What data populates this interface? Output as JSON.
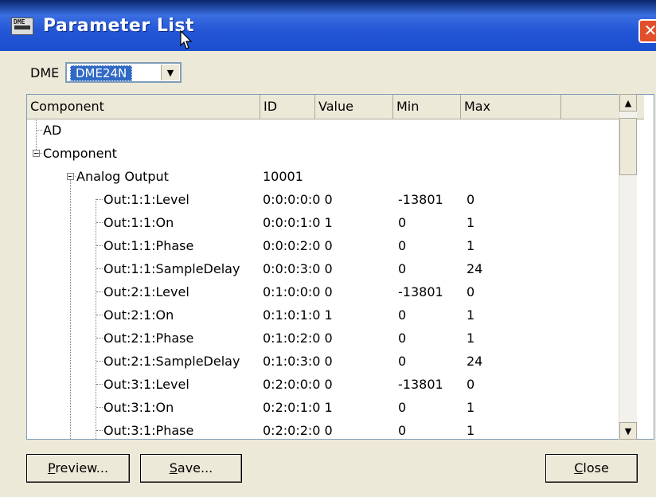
{
  "window": {
    "title": "Parameter List",
    "app_icon_text": "DME"
  },
  "dme": {
    "label": "DME",
    "selected": "DME24N"
  },
  "columns": [
    "Component",
    "ID",
    "Value",
    "Min",
    "Max"
  ],
  "rows": [
    {
      "name": "AD",
      "id": "",
      "min": "",
      "max": "",
      "level": 0
    },
    {
      "name": "Component",
      "id": "",
      "min": "",
      "max": "",
      "level": 0,
      "expanded": true
    },
    {
      "name": "Analog Output",
      "id": "10001",
      "min": "",
      "max": "",
      "level": 1,
      "expanded": true
    },
    {
      "name": "Out:1:1:Level",
      "id": "0:0:0:0:0 0",
      "min": "-13801",
      "max": "0",
      "level": 2
    },
    {
      "name": "Out:1:1:On",
      "id": "0:0:0:1:0 1",
      "min": "0",
      "max": "1",
      "level": 2
    },
    {
      "name": "Out:1:1:Phase",
      "id": "0:0:0:2:0 0",
      "min": "0",
      "max": "1",
      "level": 2
    },
    {
      "name": "Out:1:1:SampleDelay",
      "id": "0:0:0:3:0 0",
      "min": "0",
      "max": "24",
      "level": 2
    },
    {
      "name": "Out:2:1:Level",
      "id": "0:1:0:0:0 0",
      "min": "-13801",
      "max": "0",
      "level": 2
    },
    {
      "name": "Out:2:1:On",
      "id": "0:1:0:1:0 1",
      "min": "0",
      "max": "1",
      "level": 2
    },
    {
      "name": "Out:2:1:Phase",
      "id": "0:1:0:2:0 0",
      "min": "0",
      "max": "1",
      "level": 2
    },
    {
      "name": "Out:2:1:SampleDelay",
      "id": "0:1:0:3:0 0",
      "min": "0",
      "max": "24",
      "level": 2
    },
    {
      "name": "Out:3:1:Level",
      "id": "0:2:0:0:0 0",
      "min": "-13801",
      "max": "0",
      "level": 2
    },
    {
      "name": "Out:3:1:On",
      "id": "0:2:0:1:0 1",
      "min": "0",
      "max": "1",
      "level": 2
    },
    {
      "name": "Out:3:1:Phase",
      "id": "0:2:0:2:0 0",
      "min": "0",
      "max": "1",
      "level": 2
    }
  ],
  "buttons": {
    "preview": {
      "underline": "P",
      "rest": "review..."
    },
    "save": {
      "underline": "S",
      "rest": "ave..."
    },
    "close": {
      "underline": "C",
      "rest": "lose"
    }
  },
  "colors": {
    "titlebar": "#2456d6",
    "selection": "#316ac5",
    "face": "#ece9d8"
  }
}
